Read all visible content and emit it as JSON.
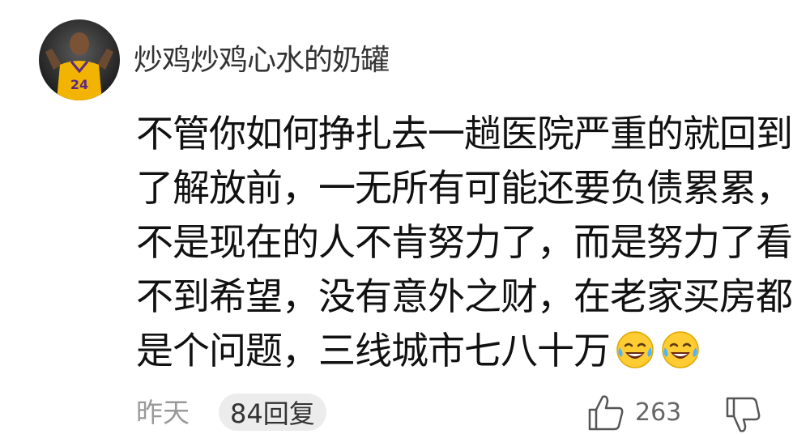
{
  "comment": {
    "username": "炒鸡炒鸡心水的奶罐",
    "avatar_icon": "user-avatar-basketball-player",
    "lines": [
      "不管你如何挣扎去一趟医院严重的就回到",
      "了解放前，一无所有可能还要负债累累，",
      "不是现在的人不肯努力了，而是努力了看",
      "不到希望，没有意外之财，在老家买房都",
      "是个问题，三线城市七八十万"
    ],
    "emojis": [
      "laughing-tears-emoji",
      "laughing-tears-emoji"
    ],
    "date": "昨天",
    "reply_button": "84回复",
    "like_count": "263",
    "like_icon": "thumbs-up-icon",
    "dislike_icon": "thumbs-down-icon"
  }
}
